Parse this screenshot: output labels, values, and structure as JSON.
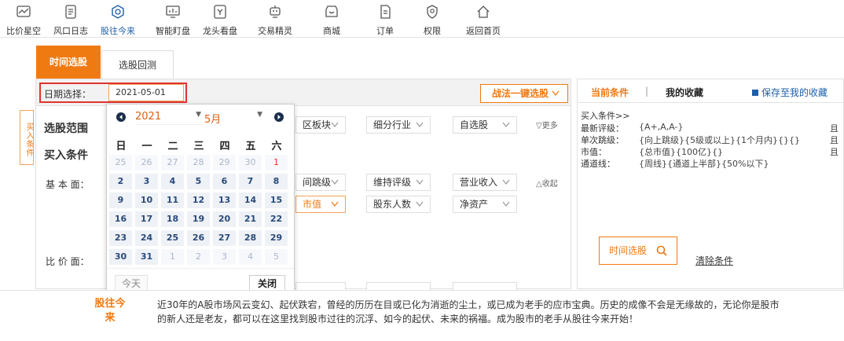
{
  "nav": [
    {
      "id": "bjxk",
      "label": "比价星空",
      "icon": "chart-icon"
    },
    {
      "id": "fkrz",
      "label": "风口日志",
      "icon": "notebook-icon"
    },
    {
      "id": "gwjl",
      "label": "股往今来",
      "icon": "compass-icon",
      "active": true
    },
    {
      "id": "zndp",
      "label": "智能盯盘",
      "icon": "monitor-icon"
    },
    {
      "id": "ltkp",
      "label": "龙头看盘",
      "icon": "board-icon"
    },
    {
      "id": "jyjl",
      "label": "交易精灵",
      "icon": "robot-icon"
    },
    {
      "id": "sc",
      "label": "商城",
      "icon": "shop-icon"
    },
    {
      "id": "dd",
      "label": "订单",
      "icon": "order-icon"
    },
    {
      "id": "qx",
      "label": "权限",
      "icon": "shield-icon"
    },
    {
      "id": "fhsy",
      "label": "返回首页",
      "icon": "home-icon"
    }
  ],
  "tabs": {
    "time_select": "时间选股",
    "backtest": "选股回测"
  },
  "date": {
    "label": "日期选择：",
    "value": "2021-05-01"
  },
  "onekey": "战法一键选股",
  "side_tab": "买入条件",
  "filters": {
    "scope_label": "选股范围",
    "buy_label": "买入条件",
    "basic_label": "基 本 面：",
    "compare_label": "比 价 面：",
    "row1": [
      "区板块",
      "细分行业",
      "自选股"
    ],
    "more": "更多",
    "row2": [
      "间跳级",
      "维持评级",
      "营业收入"
    ],
    "collapse": "收起",
    "row3": [
      "市值",
      "股东人数",
      "净资产"
    ]
  },
  "calendar": {
    "year": "2021",
    "month": "5月",
    "weekdays": [
      "日",
      "一",
      "二",
      "三",
      "四",
      "五",
      "六"
    ],
    "weeks": [
      [
        {
          "d": "25",
          "o": true
        },
        {
          "d": "26",
          "o": true
        },
        {
          "d": "27",
          "o": true
        },
        {
          "d": "28",
          "o": true
        },
        {
          "d": "29",
          "o": true
        },
        {
          "d": "30",
          "o": true
        },
        {
          "d": "1",
          "o": true,
          "red": true
        }
      ],
      [
        {
          "d": "2"
        },
        {
          "d": "3"
        },
        {
          "d": "4"
        },
        {
          "d": "5"
        },
        {
          "d": "6"
        },
        {
          "d": "7"
        },
        {
          "d": "8"
        }
      ],
      [
        {
          "d": "9"
        },
        {
          "d": "10"
        },
        {
          "d": "11"
        },
        {
          "d": "12"
        },
        {
          "d": "13"
        },
        {
          "d": "14"
        },
        {
          "d": "15"
        }
      ],
      [
        {
          "d": "16"
        },
        {
          "d": "17"
        },
        {
          "d": "18"
        },
        {
          "d": "19"
        },
        {
          "d": "20"
        },
        {
          "d": "21"
        },
        {
          "d": "22"
        }
      ],
      [
        {
          "d": "23"
        },
        {
          "d": "24"
        },
        {
          "d": "25"
        },
        {
          "d": "26"
        },
        {
          "d": "27"
        },
        {
          "d": "28"
        },
        {
          "d": "29"
        }
      ],
      [
        {
          "d": "30"
        },
        {
          "d": "31"
        },
        {
          "d": "1",
          "o": true
        },
        {
          "d": "2",
          "o": true
        },
        {
          "d": "3",
          "o": true
        },
        {
          "d": "4",
          "o": true
        },
        {
          "d": "5",
          "o": true
        }
      ]
    ],
    "today": "今天",
    "close": "关闭"
  },
  "right": {
    "tab_current": "当前条件",
    "tab_sep": "|",
    "tab_fav": "我的收藏",
    "save": "保存至我的收藏",
    "cond_title": "买入条件>>",
    "conds": [
      {
        "k": "最新评级：",
        "v": "{A+,A,A-}",
        "and": "且"
      },
      {
        "k": "单次跳级：",
        "v": "{向上跳级}{5级或以上}{1个月内}{}{}",
        "and": "且"
      },
      {
        "k": "市值：",
        "v": "{总市值}{100亿}{}",
        "and": "且"
      },
      {
        "k": "通道线：",
        "v": "{周线}{通道上半部}{50%以下}",
        "and": ""
      }
    ],
    "btn": "时间选股",
    "clear": "清除条件"
  },
  "bottom": {
    "title": "股往今来",
    "text": "近30年的A股市场风云变幻、起伏跌宕，曾经的历历在目或已化为消逝的尘土，或已成为老手的应市宝典。历史的成像不会是无缘故的，无论你是股市的新人还是老友，都可以在这里找到股市过往的沉浮、如今的起伏、未来的祸福。成为股市的老手从股往今来开始！"
  }
}
